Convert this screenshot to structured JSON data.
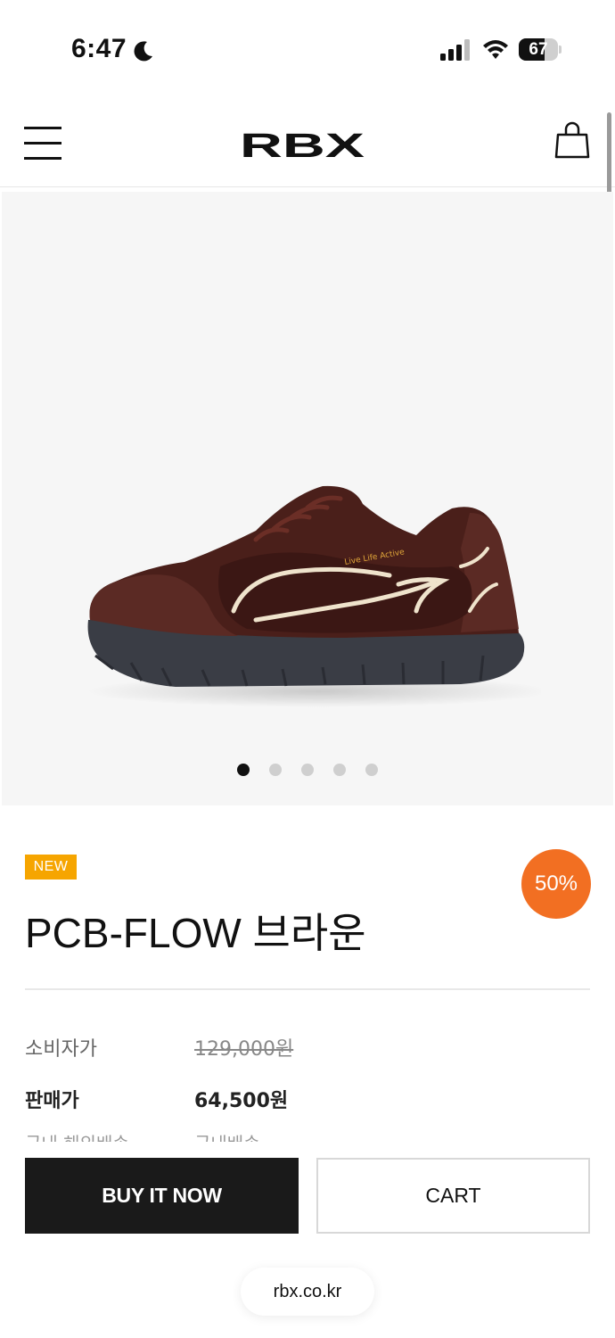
{
  "status_bar": {
    "time": "6:47",
    "battery_level": "67",
    "battery_fraction": 0.67,
    "icons": [
      "moon-icon",
      "signal-icon",
      "wifi-icon",
      "battery-icon"
    ]
  },
  "header": {
    "logo_text": "RBX",
    "icons": [
      "menu-icon",
      "shopping-bag-icon"
    ]
  },
  "carousel": {
    "total_slides": 5,
    "active_index": 0
  },
  "product": {
    "badge": "NEW",
    "discount": "50%",
    "title": "PCB-FLOW 브라운",
    "shoe_print": "Live Life Active",
    "prices": {
      "list_label": "소비자가",
      "list_value": "129,000원",
      "sale_label": "판매가",
      "sale_value": "64,500원",
      "more_label": "국내·해외배송",
      "more_value": "국내배송"
    }
  },
  "actions": {
    "buy_label": "BUY IT NOW",
    "cart_label": "CART"
  },
  "browser": {
    "url": "rbx.co.kr"
  },
  "colors": {
    "new_badge": "#f6a500",
    "discount_badge": "#f26f22",
    "buy_button": "#1a1a1a",
    "image_background": "#f6f6f6",
    "shoe_upper": "#4a1f1a",
    "shoe_sole": "#3a3d45"
  }
}
